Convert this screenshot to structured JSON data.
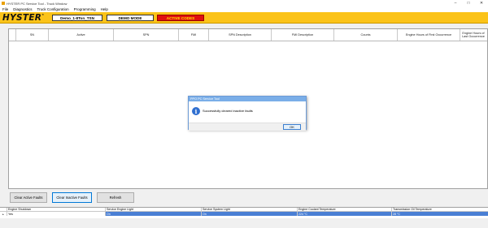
{
  "window": {
    "title": "HYSTER PC Service Tool - Truck Window"
  },
  "menu": [
    "File",
    "Diagnostics",
    "Truck Configuration",
    "Programming",
    "Help"
  ],
  "brand": {
    "logo": "HYSTER",
    "tm": "®",
    "truck_name": "Demo_1-8Ton_TSN",
    "mode": "DEMO MODE",
    "alert": "ACTIVE CODES"
  },
  "grid": {
    "columns": [
      "SN",
      "Active",
      "SPN",
      "FMI",
      "SPN Description",
      "FMI Description",
      "Counts",
      "Engine Hours of First Occurrence",
      "Engine Hours of Last Occurrence"
    ]
  },
  "dialog": {
    "title": "PPO PC Service Tool",
    "message": "Successfully cleared inactive faults",
    "ok_label": "OK"
  },
  "buttons": {
    "clear_active": "Clear Active Faults",
    "clear_inactive": "Clear Inactive Faults",
    "refresh": "Refresh"
  },
  "bottom_grid": {
    "columns": [
      "Engine Shutdown",
      "Service Engine Light",
      "Service System Light",
      "Engine Coolant Temperature",
      "Transmission Oil Temperature"
    ],
    "row": [
      "Yes",
      "On",
      "On",
      "224 °C",
      "28 °C"
    ]
  }
}
